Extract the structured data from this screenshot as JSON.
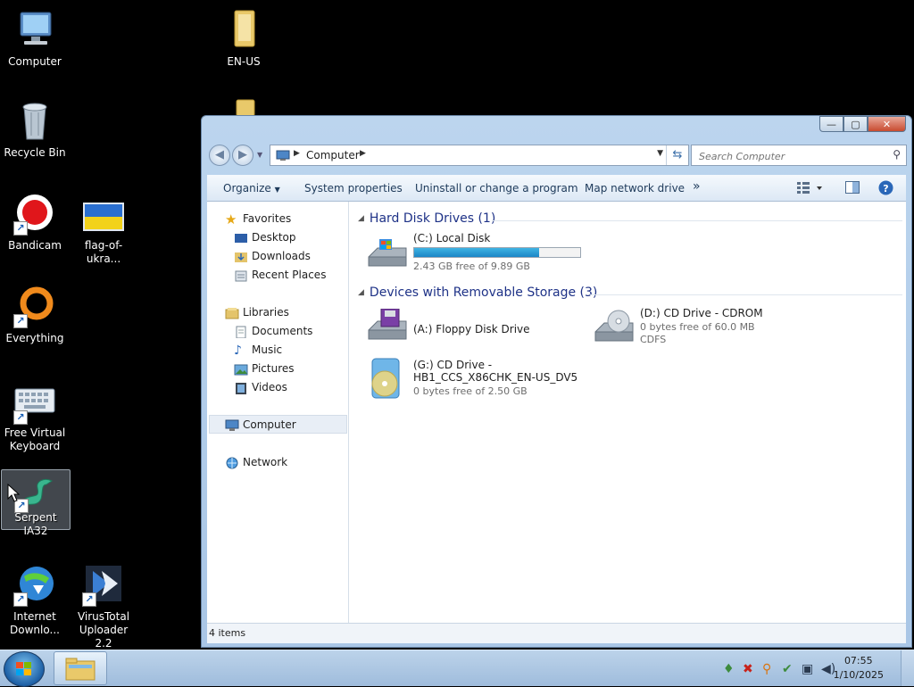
{
  "desktop": {
    "icons": [
      {
        "label": "Computer"
      },
      {
        "label": "EN-US"
      },
      {
        "label": "Recycle Bin"
      },
      {
        "label": "Bandicam"
      },
      {
        "label": "flag-of-ukra..."
      },
      {
        "label": "Everything"
      },
      {
        "label": "Free Virtual Keyboard"
      },
      {
        "label": "Serpent IA32"
      },
      {
        "label": "Internet Downlo..."
      },
      {
        "label": "VirusTotal Uploader 2.2"
      }
    ]
  },
  "window": {
    "address": {
      "crumb": "Computer"
    },
    "search": {
      "placeholder": "Search Computer"
    },
    "toolbar": {
      "organize": "Organize",
      "system_properties": "System properties",
      "uninstall": "Uninstall or change a program",
      "map_drive": "Map network drive",
      "more": "»"
    },
    "nav": {
      "favorites": "Favorites",
      "desktop": "Desktop",
      "downloads": "Downloads",
      "recent_places": "Recent Places",
      "libraries": "Libraries",
      "documents": "Documents",
      "music": "Music",
      "pictures": "Pictures",
      "videos": "Videos",
      "computer": "Computer",
      "network": "Network"
    },
    "groups": {
      "hdd": "Hard Disk Drives (1)",
      "removable": "Devices with Removable Storage (3)"
    },
    "drives": {
      "c": {
        "name": "(C:) Local Disk",
        "free": "2.43 GB free of 9.89 GB",
        "used_fraction": 0.754
      },
      "a": {
        "name": "(A:) Floppy Disk Drive"
      },
      "d": {
        "name": "(D:) CD Drive - CDROM",
        "free": "0 bytes free of 60.0 MB",
        "fs": "CDFS"
      },
      "g": {
        "name_line1": "(G:) CD Drive -",
        "name_line2": "HB1_CCS_X86CHK_EN-US_DV5",
        "free": "0 bytes free of 2.50 GB"
      }
    },
    "status": "4 items"
  },
  "taskbar": {
    "time": "07:55",
    "date": "1/10/2025"
  }
}
